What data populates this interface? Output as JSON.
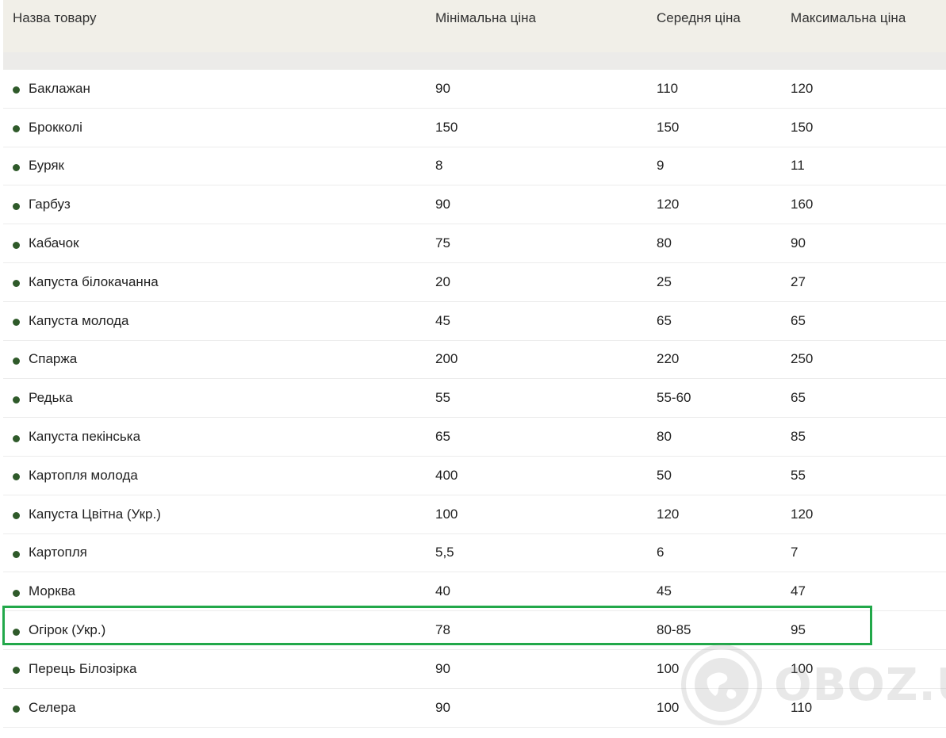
{
  "table": {
    "headers": [
      "Назва товару",
      "Мінімальна ціна",
      "Середня ціна",
      "Максимальна ціна"
    ],
    "rows": [
      [
        "Баклажан",
        "90",
        "110",
        "120"
      ],
      [
        "Брокколі",
        "150",
        "150",
        "150"
      ],
      [
        "Буряк",
        "8",
        "9",
        "11"
      ],
      [
        "Гарбуз",
        "90",
        "120",
        "160"
      ],
      [
        "Кабачок",
        "75",
        "80",
        "90"
      ],
      [
        "Капуста білокачанна",
        "20",
        "25",
        "27"
      ],
      [
        "Капуста молода",
        "45",
        "65",
        "65"
      ],
      [
        "Спаржа",
        "200",
        "220",
        "250"
      ],
      [
        "Редька",
        "55",
        "55-60",
        "65"
      ],
      [
        "Капуста пекінська",
        "65",
        "80",
        "85"
      ],
      [
        "Картопля молода",
        "400",
        "50",
        "55"
      ],
      [
        "Капуста Цвітна (Укр.)",
        "100",
        "120",
        "120"
      ],
      [
        "Картопля",
        "5,5",
        "6",
        "7"
      ],
      [
        "Морква",
        "40",
        "45",
        "47"
      ],
      [
        "Огірок (Укр.)",
        "78",
        "80-85",
        "95"
      ],
      [
        "Перець Білозірка",
        "90",
        "100",
        "100"
      ],
      [
        "Селера",
        "90",
        "100",
        "110"
      ]
    ],
    "highlighted_row": "Огірок (Укр.)"
  },
  "watermark": {
    "text": "OBOZ.UA",
    "icon": "globe-icon"
  },
  "colors": {
    "header_bg": "#f1efe8",
    "bullet": "#2f5a2a",
    "highlight_border": "#22a84a"
  }
}
